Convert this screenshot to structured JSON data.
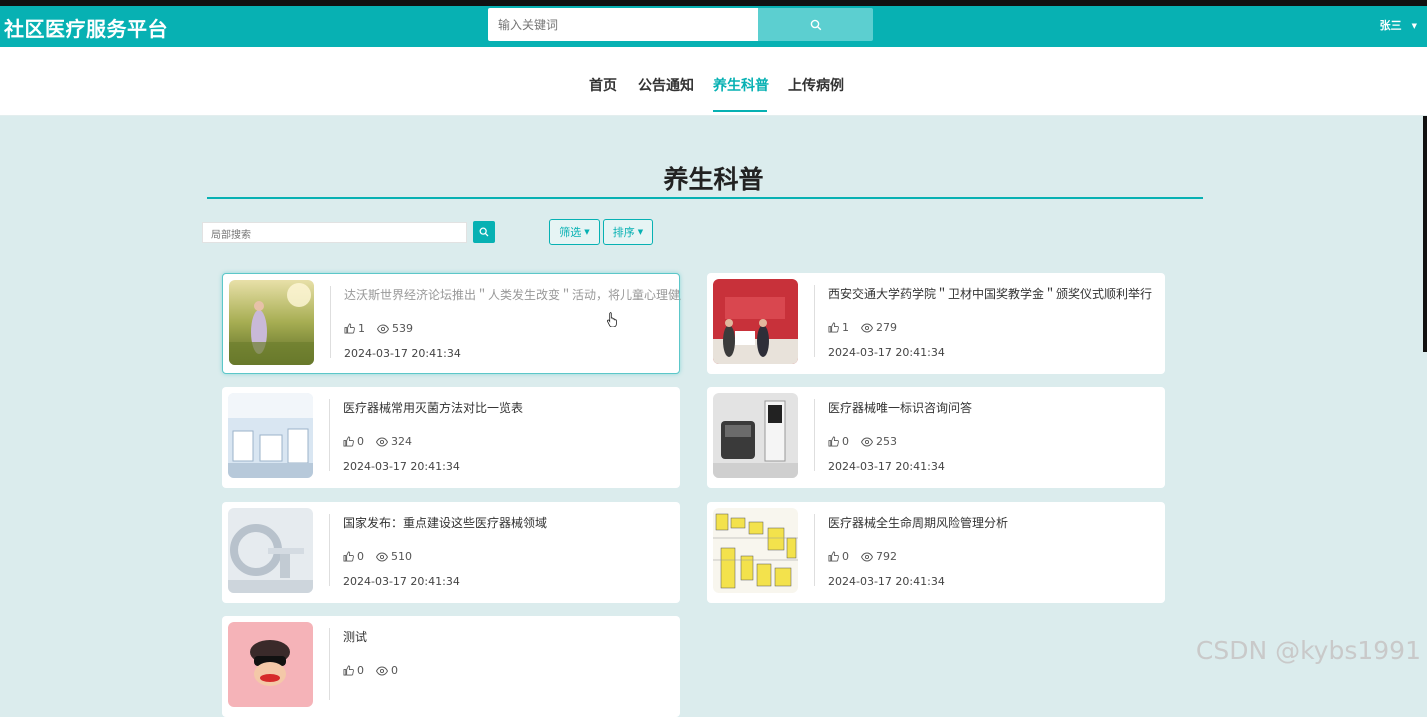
{
  "header": {
    "brand": "社区医疗服务平台",
    "search_placeholder": "输入关键词",
    "user_name": "张三"
  },
  "nav": {
    "items": [
      {
        "label": "首页",
        "active": false
      },
      {
        "label": "公告通知",
        "active": false
      },
      {
        "label": "养生科普",
        "active": true
      },
      {
        "label": "上传病例",
        "active": false
      }
    ]
  },
  "page": {
    "title": "养生科普",
    "local_search_placeholder": "局部搜索",
    "filter_label": "筛选",
    "sort_label": "排序"
  },
  "articles": [
    {
      "title": "达沃斯世界经济论坛推出＂人类发生改变＂活动，将儿童心理健康列",
      "likes": "1",
      "views": "539",
      "time": "2024-03-17 20:41:34",
      "image": "field-girl-photo"
    },
    {
      "title": "西安交通大学药学院＂卫材中国奖教学金＂颁奖仪式顺利举行",
      "likes": "1",
      "views": "279",
      "time": "2024-03-17 20:41:34",
      "image": "award-ceremony-photo"
    },
    {
      "title": "医疗器械常用灭菌方法对比一览表",
      "likes": "0",
      "views": "324",
      "time": "2024-03-17 20:41:34",
      "image": "lab-photo"
    },
    {
      "title": "医疗器械唯一标识咨询问答",
      "likes": "0",
      "views": "253",
      "time": "2024-03-17 20:41:34",
      "image": "surgical-robot-photo"
    },
    {
      "title": "国家发布：重点建设这些医疗器械领域",
      "likes": "0",
      "views": "510",
      "time": "2024-03-17 20:41:34",
      "image": "ct-scanner-photo"
    },
    {
      "title": "医疗器械全生命周期风险管理分析",
      "likes": "0",
      "views": "792",
      "time": "2024-03-17 20:41:34",
      "image": "flowchart-image"
    },
    {
      "title": "测试",
      "likes": "0",
      "views": "0",
      "time": "",
      "image": "cartoon-monkey-image"
    }
  ],
  "watermark": "CSDN @kybs1991",
  "colors": {
    "accent": "#07b1b3",
    "background": "#dbeced"
  }
}
